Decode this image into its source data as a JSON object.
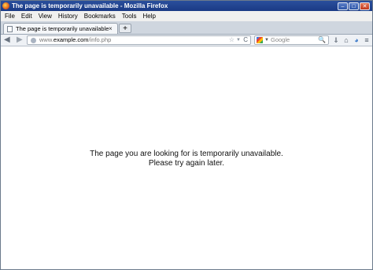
{
  "window": {
    "title": "The page is temporarily unavailable - Mozilla Firefox",
    "minimize_glyph": "–",
    "maximize_glyph": "□",
    "close_glyph": "✕"
  },
  "menu": {
    "items": [
      "File",
      "Edit",
      "View",
      "History",
      "Bookmarks",
      "Tools",
      "Help"
    ]
  },
  "tabs": [
    {
      "label": "The page is temporarily unavailable",
      "close_glyph": "×"
    }
  ],
  "new_tab_glyph": "+",
  "navigation": {
    "back_glyph": "◀",
    "forward_glyph": "▶",
    "url_prefix": "www.",
    "url_domain": "example.com",
    "url_path": "/info.php",
    "bookmark_star_glyph": "☆",
    "dropdown_glyph": "▼",
    "reload_glyph": "C"
  },
  "search": {
    "placeholder": "Google",
    "engine_dropdown_glyph": "▼",
    "search_glyph": "🔍"
  },
  "toolbar_icons": {
    "downloads_glyph": "⇓",
    "home_glyph": "⌂",
    "addon_glyph": "◕",
    "menu_glyph": "≡"
  },
  "content": {
    "line1": "The page you are looking for is temporarily unavailable.",
    "line2": "Please try again later."
  }
}
